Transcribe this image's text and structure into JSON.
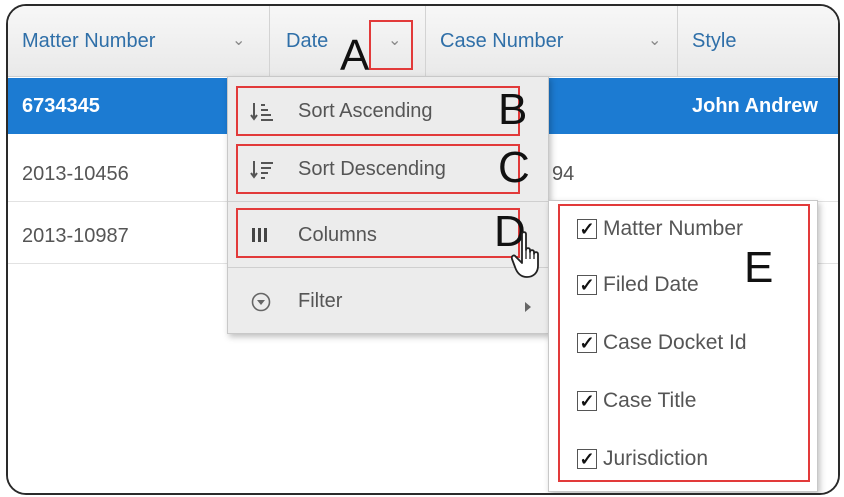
{
  "grid": {
    "columns": [
      {
        "label": "Matter Number"
      },
      {
        "label": "Date"
      },
      {
        "label": "Case Number"
      },
      {
        "label": "Style"
      }
    ],
    "rows": [
      {
        "matter": "6734345",
        "style": "John Andrew",
        "extra": "",
        "selected": true
      },
      {
        "matter": "2013-10456",
        "style": "",
        "extra": "94",
        "selected": false
      },
      {
        "matter": "2013-10987",
        "style": "",
        "extra": "",
        "selected": false
      }
    ]
  },
  "menu": {
    "items": [
      {
        "label": "Sort Ascending",
        "icon": "sort-ascending-icon"
      },
      {
        "label": "Sort Descending",
        "icon": "sort-descending-icon"
      },
      {
        "label": "Columns",
        "icon": "columns-icon"
      },
      {
        "label": "Filter",
        "icon": "filter-icon"
      }
    ]
  },
  "columns_menu": {
    "items": [
      {
        "label": "Matter Number",
        "checked": true
      },
      {
        "label": "Filed Date",
        "checked": true
      },
      {
        "label": "Case Docket Id",
        "checked": true
      },
      {
        "label": "Case Title",
        "checked": true
      },
      {
        "label": "Jurisdiction",
        "checked": true
      }
    ]
  },
  "annotations": {
    "a": "A",
    "b": "B",
    "c": "C",
    "d": "D",
    "e": "E"
  },
  "colors": {
    "selected_row": "#1c7bd2",
    "header_text": "#2f6fa8",
    "callout": "#e23a3a"
  }
}
